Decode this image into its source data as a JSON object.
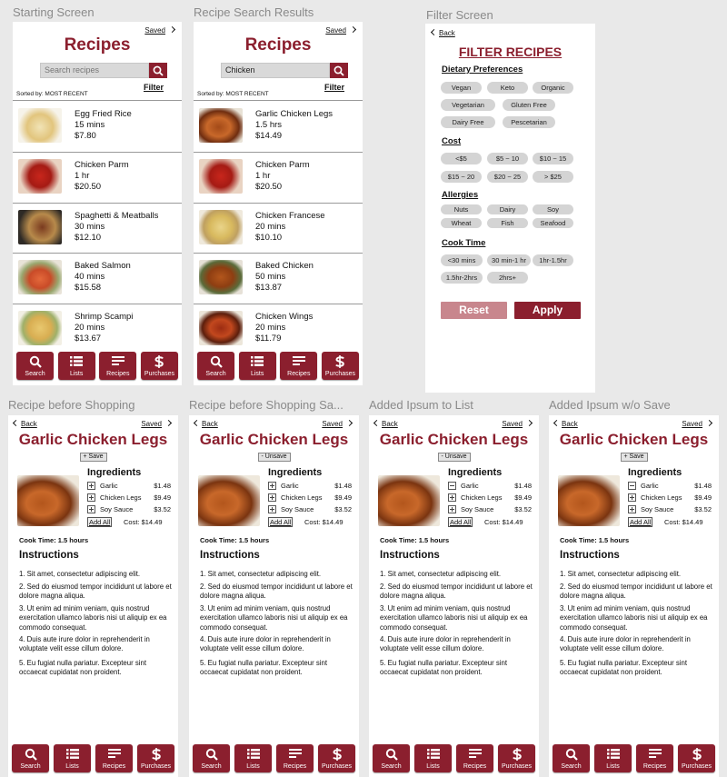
{
  "colors": {
    "accent": "#8b1f2e",
    "accent_light": "#c8868d",
    "chip": "#d4d4d4",
    "canvas": "#e9e9e9"
  },
  "frames": {
    "starting": "Starting Screen",
    "results": "Recipe Search Results",
    "filter": "Filter Screen",
    "before": "Recipe before Shopping",
    "before_saved": "Recipe before Shopping Sa...",
    "added": "Added Ipsum to List",
    "added_nosave": "Added Ipsum w/o Save"
  },
  "common": {
    "app_title": "Recipes",
    "saved": "Saved",
    "filter": "Filter",
    "sorted": "Sorted by: MOST RECENT",
    "back": "Back",
    "tabs": [
      "Search",
      "Lists",
      "Recipes",
      "Purchases"
    ]
  },
  "starting": {
    "search_placeholder": "Search recipes",
    "recipes": [
      {
        "name": "Egg Fried Rice",
        "time": "15 mins",
        "price": "$7.80"
      },
      {
        "name": "Chicken Parm",
        "time": "1 hr",
        "price": "$20.50"
      },
      {
        "name": "Spaghetti & Meatballs",
        "time": "30 mins",
        "price": "$12.10"
      },
      {
        "name": "Baked Salmon",
        "time": "40 mins",
        "price": "$15.58"
      },
      {
        "name": "Shrimp Scampi",
        "time": "20 mins",
        "price": "$13.67"
      }
    ]
  },
  "results": {
    "search_value": "Chicken",
    "recipes": [
      {
        "name": "Garlic Chicken Legs",
        "time": "1.5 hrs",
        "price": "$14.49"
      },
      {
        "name": "Chicken Parm",
        "time": "1 hr",
        "price": "$20.50"
      },
      {
        "name": "Chicken Francese",
        "time": "20 mins",
        "price": "$10.10"
      },
      {
        "name": "Baked Chicken",
        "time": "50 mins",
        "price": "$13.87"
      },
      {
        "name": "Chicken Wings",
        "time": "20 mins",
        "price": "$11.79"
      }
    ]
  },
  "filter": {
    "title": "FILTER RECIPES",
    "dietary": {
      "heading": "Dietary Preferences",
      "chips": [
        "Vegan",
        "Keto",
        "Organic",
        "Vegetarian",
        "Gluten Free",
        "Dairy Free",
        "Pescetarian"
      ]
    },
    "cost": {
      "heading": "Cost",
      "chips": [
        "<$5",
        "$5 ~ 10",
        "$10 ~ 15",
        "$15 ~ 20",
        "$20 ~ 25",
        "> $25"
      ]
    },
    "allergies": {
      "heading": "Allergies",
      "chips": [
        "Nuts",
        "Dairy",
        "Soy",
        "Wheat",
        "Fish",
        "Seafood"
      ]
    },
    "cooktime": {
      "heading": "Cook Time",
      "chips": [
        "<30 mins",
        "30 min-1 hr",
        "1hr-1.5hr",
        "1.5hr-2hrs",
        "2hrs+"
      ]
    },
    "reset": "Reset",
    "apply": "Apply"
  },
  "detail": {
    "title": "Garlic Chicken Legs",
    "ingredients_heading": "Ingredients",
    "ingredients": [
      {
        "name": "Garlic",
        "price": "$1.48"
      },
      {
        "name": "Chicken Legs",
        "price": "$9.49"
      },
      {
        "name": "Soy Sauce",
        "price": "$3.52"
      }
    ],
    "add_all": "Add All",
    "cost": "Cost: $14.49",
    "cook_time": "Cook Time: 1.5 hours",
    "instructions_heading": "Instructions",
    "steps": [
      "1. Sit amet, consectetur adipiscing elit.",
      "2. Sed do eiusmod tempor incididunt ut labore et dolore magna aliqua.",
      "3. Ut enim ad minim veniam, quis nostrud exercitation ullamco laboris nisi ut aliquip ex ea commodo consequat.",
      "4. Duis aute irure dolor in reprehenderit in voluptate velit esse cillum dolore.",
      "5. Eu fugiat nulla pariatur. Excepteur sint occaecat cupidatat non proident."
    ],
    "save_label": "+ Save",
    "unsave_label": "- Unsave"
  }
}
